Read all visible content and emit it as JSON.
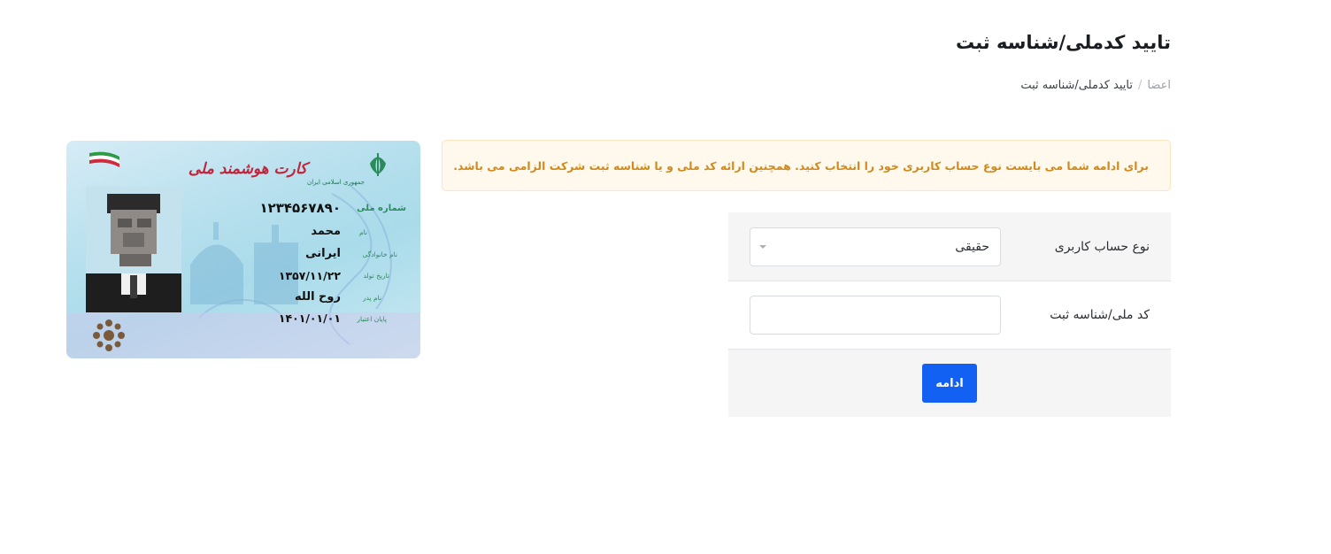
{
  "header": {
    "title": "تایید کدملی/شناسه ثبت",
    "breadcrumb": {
      "parent": "اعضا",
      "separator": "/",
      "current": "تایید کدملی/شناسه ثبت"
    }
  },
  "alert": {
    "text": "برای ادامه شما می بایست نوع حساب کاربری خود را انتخاب کنید. همچنین ارائه کد ملی و یا شناسه ثبت شرکت الزامی می باشد.",
    "color": "#d08a1e"
  },
  "form": {
    "account_type": {
      "label": "نوع حساب کاربری",
      "selected": "حقیقی"
    },
    "national_id": {
      "label": "کد ملی/شناسه ثبت",
      "value": ""
    },
    "submit_label": "ادامه",
    "submit_color": "#1261f2"
  },
  "id_card": {
    "title": "کارت هوشمند ملی",
    "country": "جمهوری اسلامی ایران",
    "fields": {
      "national_number": {
        "label": "شماره ملی",
        "value": "۱۲۳۴۵۶۷۸۹۰"
      },
      "name": {
        "label": "نام",
        "value": "محمد"
      },
      "family": {
        "label": "نام خانوادگی",
        "value": "ایرانی"
      },
      "birth_date": {
        "label": "تاریخ تولد",
        "value": "۱۳۵۷/۱۱/۲۲"
      },
      "father_name": {
        "label": "نام پدر",
        "value": "روح الله"
      },
      "expiry": {
        "label": "پایان اعتبار",
        "value": "۱۴۰۱/۰۱/۰۱"
      }
    }
  }
}
